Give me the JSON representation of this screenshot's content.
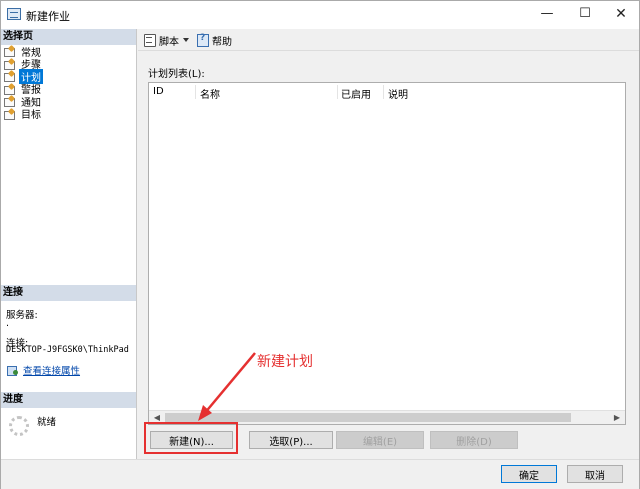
{
  "window": {
    "title": "新建作业",
    "minimize_glyph": "—",
    "maximize_glyph": "☐",
    "close_glyph": "✕"
  },
  "left": {
    "select_page_header": "选择页",
    "nav_items": [
      {
        "label": "常规",
        "selected": false
      },
      {
        "label": "步骤",
        "selected": false
      },
      {
        "label": "计划",
        "selected": true
      },
      {
        "label": "警报",
        "selected": false
      },
      {
        "label": "通知",
        "selected": false
      },
      {
        "label": "目标",
        "selected": false
      }
    ],
    "connection_header": "连接",
    "server_label": "服务器:",
    "server_value": ".",
    "connection_label": "连接:",
    "connection_value": "DESKTOP-J9FGSK0\\ThinkPad",
    "view_connection_link": "查看连接属性",
    "progress_header": "进度",
    "progress_status": "就绪"
  },
  "toolbar": {
    "script_label": "脚本",
    "help_label": "帮助"
  },
  "schedule": {
    "list_label": "计划列表(L):",
    "columns": [
      "ID",
      "名称",
      "已启用",
      "说明"
    ],
    "rows": [],
    "new_button": "新建(N)...",
    "pick_button": "选取(P)...",
    "edit_button": "编辑(E)",
    "delete_button": "删除(D)"
  },
  "footer": {
    "ok_button": "确定",
    "cancel_button": "取消"
  },
  "annotation": {
    "text": "新建计划",
    "color": "#e53030"
  },
  "colors": {
    "selection": "#0078d7",
    "section_header": "#d3dce8",
    "link": "#0046aa"
  }
}
